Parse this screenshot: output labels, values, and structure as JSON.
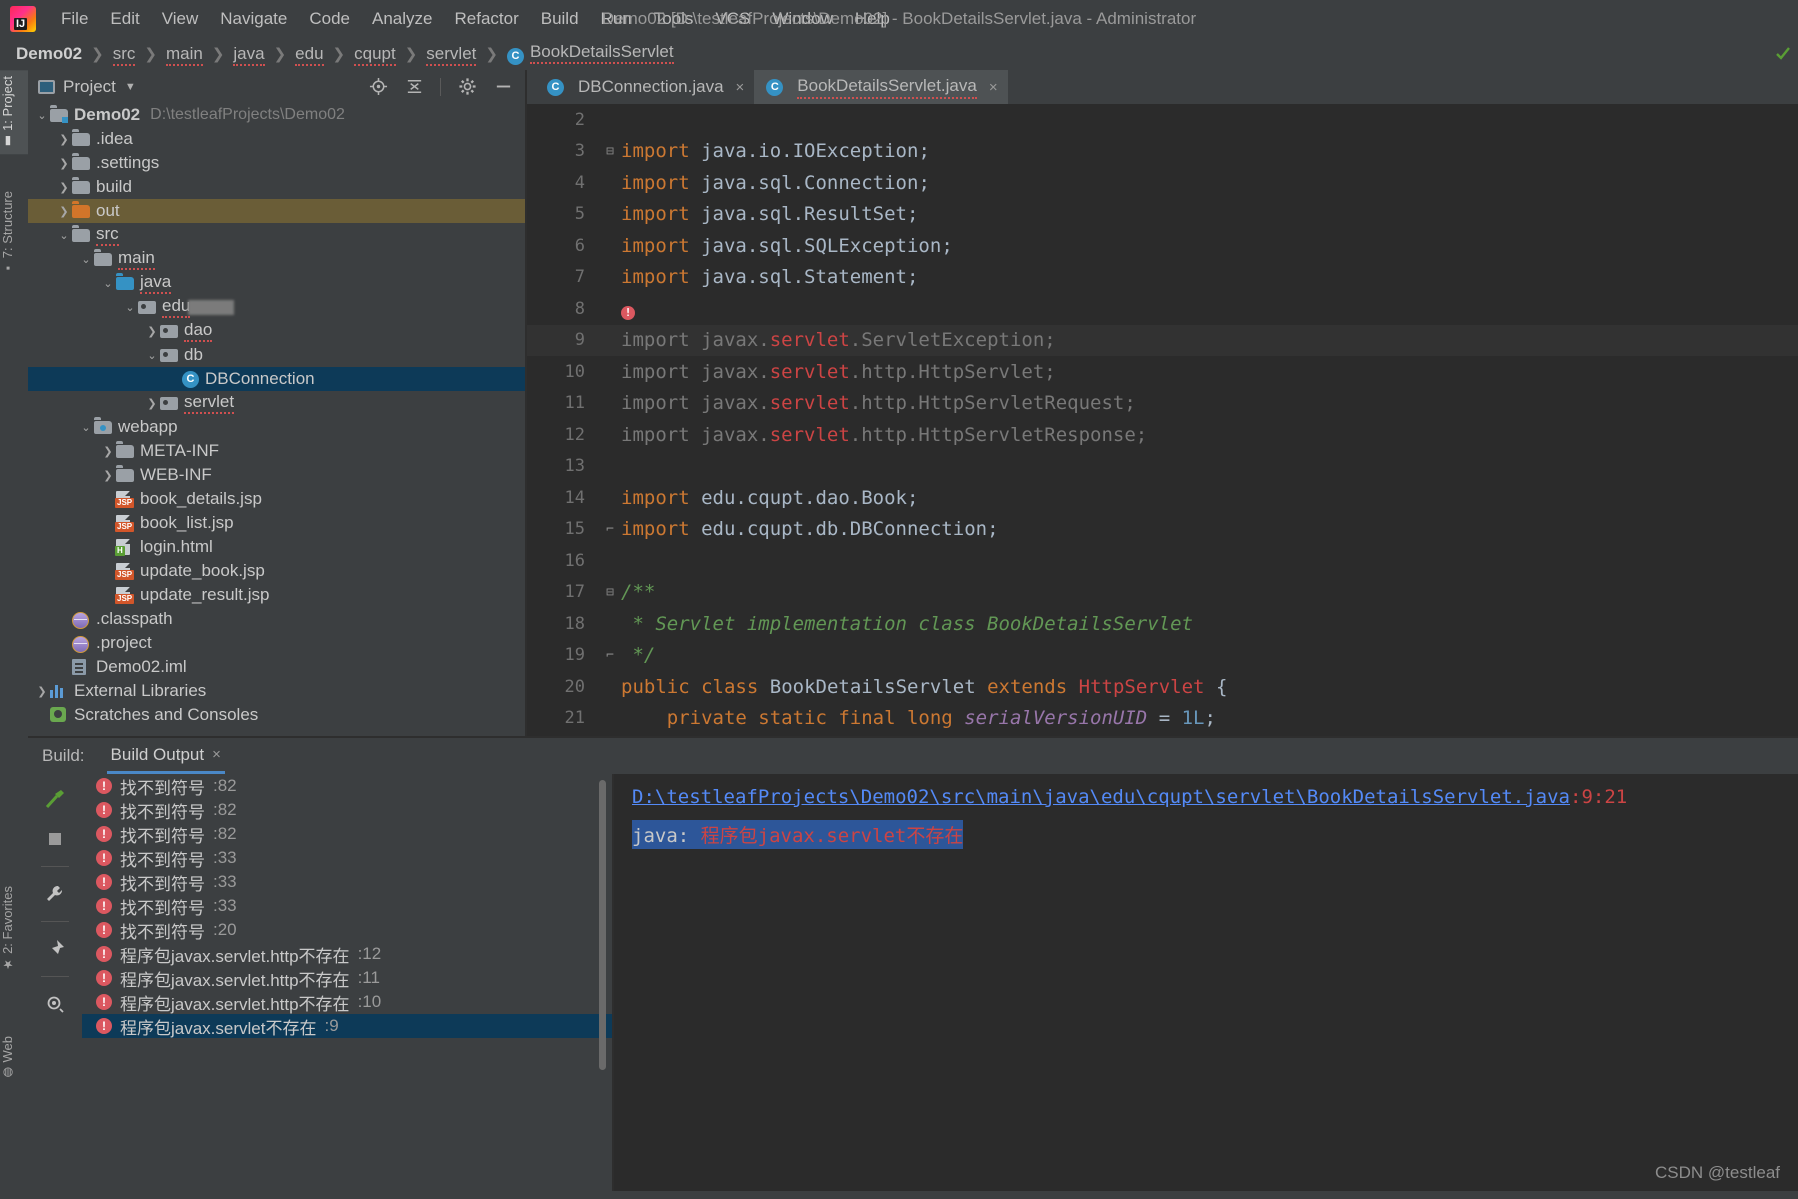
{
  "window": {
    "title": "Demo02 [D:\\testleafProjects\\Demo02] - BookDetailsServlet.java - Administrator",
    "app_icon": "intellij-idea-logo"
  },
  "menu": [
    {
      "label": "File"
    },
    {
      "label": "Edit"
    },
    {
      "label": "View"
    },
    {
      "label": "Navigate"
    },
    {
      "label": "Code"
    },
    {
      "label": "Analyze"
    },
    {
      "label": "Refactor"
    },
    {
      "label": "Build"
    },
    {
      "label": "Run"
    },
    {
      "label": "Tools"
    },
    {
      "label": "VCS"
    },
    {
      "label": "Window"
    },
    {
      "label": "Help"
    }
  ],
  "breadcrumb": {
    "items": [
      "Demo02",
      "src",
      "main",
      "java",
      "edu",
      "cqupt",
      "servlet"
    ],
    "current": "BookDetailsServlet",
    "class_badge": "C"
  },
  "left_tool_tabs": [
    {
      "label": "1: Project",
      "selected": true
    },
    {
      "label": "7: Structure",
      "selected": false
    },
    {
      "label": "2: Favorites",
      "selected": false
    },
    {
      "label": "Web",
      "selected": false
    }
  ],
  "project_panel": {
    "title": "Project",
    "tools": [
      "locate-icon",
      "collapse-all-icon",
      "settings-gear-icon",
      "minimize-icon"
    ],
    "tree": [
      {
        "label": "Demo02",
        "detail": "D:\\testleafProjects\\Demo02",
        "indent": 0,
        "arrow": "down",
        "icon": "module-folder",
        "bold": true
      },
      {
        "label": ".idea",
        "indent": 1,
        "arrow": "right",
        "icon": "folder-grey"
      },
      {
        "label": ".settings",
        "indent": 1,
        "arrow": "right",
        "icon": "folder-grey"
      },
      {
        "label": "build",
        "indent": 1,
        "arrow": "right",
        "icon": "folder-grey"
      },
      {
        "label": "out",
        "indent": 1,
        "arrow": "right",
        "icon": "folder-orange",
        "highlight": "amber"
      },
      {
        "label": "src",
        "indent": 1,
        "arrow": "down",
        "icon": "folder-grey"
      },
      {
        "label": "main",
        "indent": 2,
        "arrow": "down",
        "icon": "folder-grey"
      },
      {
        "label": "java",
        "indent": 3,
        "arrow": "down",
        "icon": "folder-blue"
      },
      {
        "label": "edu",
        "indent": 4,
        "arrow": "down",
        "icon": "package",
        "redacted": true
      },
      {
        "label": "dao",
        "indent": 5,
        "arrow": "right",
        "icon": "package"
      },
      {
        "label": "db",
        "indent": 5,
        "arrow": "down",
        "icon": "package"
      },
      {
        "label": "DBConnection",
        "indent": 6,
        "arrow": "none",
        "icon": "java-class",
        "highlight": "blue"
      },
      {
        "label": "servlet",
        "indent": 5,
        "arrow": "right",
        "icon": "package"
      },
      {
        "label": "webapp",
        "indent": 2,
        "arrow": "down",
        "icon": "webapp-folder"
      },
      {
        "label": "META-INF",
        "indent": 3,
        "arrow": "right",
        "icon": "folder-grey"
      },
      {
        "label": "WEB-INF",
        "indent": 3,
        "arrow": "right",
        "icon": "folder-grey"
      },
      {
        "label": "book_details.jsp",
        "indent": 3,
        "arrow": "none",
        "icon": "jsp-file"
      },
      {
        "label": "book_list.jsp",
        "indent": 3,
        "arrow": "none",
        "icon": "jsp-file"
      },
      {
        "label": "login.html",
        "indent": 3,
        "arrow": "none",
        "icon": "html-file"
      },
      {
        "label": "update_book.jsp",
        "indent": 3,
        "arrow": "none",
        "icon": "jsp-file"
      },
      {
        "label": "update_result.jsp",
        "indent": 3,
        "arrow": "none",
        "icon": "jsp-file"
      },
      {
        "label": ".classpath",
        "indent": 1,
        "arrow": "none",
        "icon": "xml-orb"
      },
      {
        "label": ".project",
        "indent": 1,
        "arrow": "none",
        "icon": "xml-orb"
      },
      {
        "label": "Demo02.iml",
        "indent": 1,
        "arrow": "none",
        "icon": "iml-file"
      },
      {
        "label": "External Libraries",
        "indent": 0,
        "arrow": "right",
        "icon": "libraries"
      },
      {
        "label": "Scratches and Consoles",
        "indent": 0,
        "arrow": "none",
        "icon": "scratches"
      }
    ]
  },
  "editor": {
    "tabs": [
      {
        "label": "DBConnection.java",
        "active": false,
        "badge": "C",
        "close": "×"
      },
      {
        "label": "BookDetailsServlet.java",
        "active": true,
        "badge": "C",
        "close": "×"
      }
    ],
    "lines": [
      {
        "no": "2",
        "kind": "blank"
      },
      {
        "no": "3",
        "kind": "import",
        "fold": "minus",
        "pkg": "java.io.IOException"
      },
      {
        "no": "4",
        "kind": "import",
        "pkg": "java.sql.Connection"
      },
      {
        "no": "5",
        "kind": "import",
        "pkg": "java.sql.ResultSet"
      },
      {
        "no": "6",
        "kind": "import",
        "pkg": "java.sql.SQLException"
      },
      {
        "no": "7",
        "kind": "import",
        "pkg": "java.sql.Statement"
      },
      {
        "no": "8",
        "kind": "bulb"
      },
      {
        "no": "9",
        "kind": "import-bad",
        "highlight": true,
        "pre": "import javax.",
        "bad": "servlet",
        "post": ".ServletException;"
      },
      {
        "no": "10",
        "kind": "import-bad",
        "pre": "import javax.",
        "bad": "servlet",
        "post": ".http.HttpServlet;"
      },
      {
        "no": "11",
        "kind": "import-bad",
        "pre": "import javax.",
        "bad": "servlet",
        "post": ".http.HttpServletRequest;"
      },
      {
        "no": "12",
        "kind": "import-bad",
        "pre": "import javax.",
        "bad": "servlet",
        "post": ".http.HttpServletResponse;"
      },
      {
        "no": "13",
        "kind": "blank"
      },
      {
        "no": "14",
        "kind": "import",
        "pkg": "edu.cqupt.dao.Book"
      },
      {
        "no": "15",
        "kind": "import",
        "fold": "end",
        "pkg": "edu.cqupt.db.DBConnection"
      },
      {
        "no": "16",
        "kind": "blank"
      },
      {
        "no": "17",
        "kind": "comment",
        "fold": "minus",
        "text": "/**"
      },
      {
        "no": "18",
        "kind": "comment",
        "text": " * Servlet implementation class BookDetailsServlet"
      },
      {
        "no": "19",
        "kind": "comment",
        "fold": "end",
        "text": " */"
      },
      {
        "no": "20",
        "kind": "class-decl",
        "text": "public class BookDetailsServlet extends HttpServlet {"
      },
      {
        "no": "21",
        "kind": "field-decl",
        "text": "private static final long serialVersionUID = 1L;"
      }
    ]
  },
  "build_panel": {
    "label": "Build:",
    "tab": "Build Output",
    "tab_close": "×",
    "side_tools": [
      "build-hammer-icon",
      "stop-icon",
      "settings-wrench-icon",
      "pin-icon",
      "eye-filter-icon"
    ],
    "messages": [
      {
        "text": "程序包javax.servlet不存在",
        "line": ":9",
        "selected": true
      },
      {
        "text": "程序包javax.servlet.http不存在",
        "line": ":10"
      },
      {
        "text": "程序包javax.servlet.http不存在",
        "line": ":11"
      },
      {
        "text": "程序包javax.servlet.http不存在",
        "line": ":12"
      },
      {
        "text": "找不到符号",
        "line": ":20"
      },
      {
        "text": "找不到符号",
        "line": ":33"
      },
      {
        "text": "找不到符号",
        "line": ":33"
      },
      {
        "text": "找不到符号",
        "line": ":33"
      },
      {
        "text": "找不到符号",
        "line": ":82"
      },
      {
        "text": "找不到符号",
        "line": ":82"
      },
      {
        "text": "找不到符号",
        "line": ":82"
      }
    ],
    "detail": {
      "path": "D:\\testleafProjects\\Demo02\\src\\main\\java\\edu\\cqupt\\servlet\\BookDetailsServlet.java",
      "position": ":9:21",
      "message_prefix": "java: ",
      "message_body": "程序包javax.servlet不存在"
    }
  },
  "watermark": "CSDN @testleaf",
  "colors": {
    "window_bg": "#3c3f41",
    "editor_bg": "#2b2b2b",
    "selection_blue": "#0d3a58",
    "selection_amber": "#6a5d37",
    "accent_blue": "#4a88c7",
    "error_red": "#db5860",
    "keyword_orange": "#cc7832",
    "comment_green": "#629755",
    "link_blue": "#548af7"
  }
}
